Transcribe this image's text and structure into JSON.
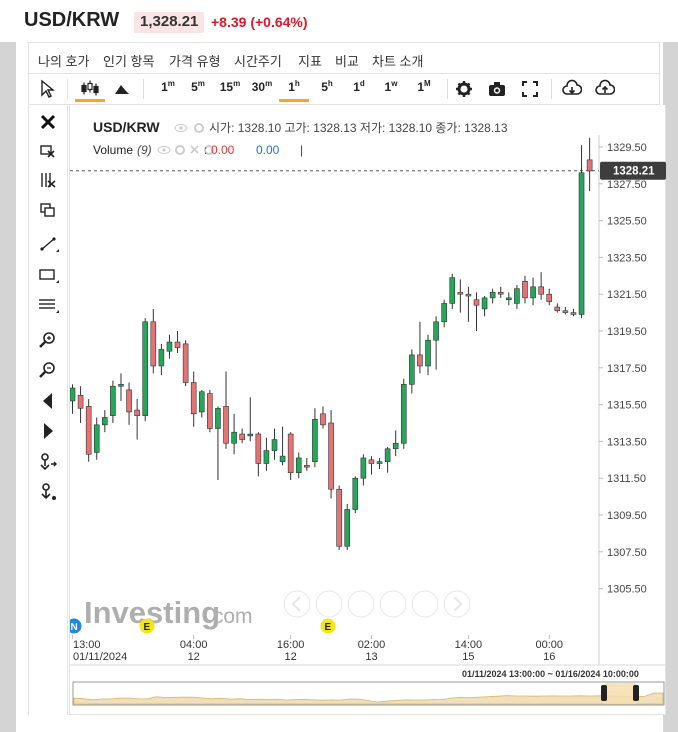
{
  "header": {
    "pair": "USD/KRW",
    "price": "1,328.21",
    "change": "+8.39 (+0.64%)"
  },
  "menu": [
    {
      "label": "나의 호가"
    },
    {
      "label": "인기 항목"
    },
    {
      "label": "가격 유형"
    },
    {
      "label": "시간주기"
    },
    {
      "label": "지표"
    },
    {
      "label": "비교"
    },
    {
      "label": "차트 소개"
    }
  ],
  "toolbar": {
    "intervals": [
      {
        "base": "1",
        "sup": "m"
      },
      {
        "base": "5",
        "sup": "m"
      },
      {
        "base": "15",
        "sup": "m"
      },
      {
        "base": "30",
        "sup": "m"
      },
      {
        "base": "1",
        "sup": "h",
        "active": true
      },
      {
        "base": "5",
        "sup": "h"
      },
      {
        "base": "1",
        "sup": "d"
      },
      {
        "base": "1",
        "sup": "w"
      },
      {
        "base": "1",
        "sup": "M"
      }
    ],
    "icons": [
      "cursor-icon",
      "candles-icon",
      "mountain-icon",
      "gear-icon",
      "camera-icon",
      "fullscreen-icon",
      "download-icon",
      "upload-icon"
    ]
  },
  "left_tools": [
    "close-icon",
    "cursor-cross-icon",
    "eraser-icon",
    "copy-icon",
    "line-tool-icon",
    "rectangle-tool-icon",
    "fibonacci-icon",
    "zoom-in-icon",
    "zoom-out-icon",
    "scroll-left-icon",
    "scroll-right-icon",
    "magnet-icon",
    "measure-icon"
  ],
  "legend": {
    "symbol": "USD/KRW",
    "ohlc": "시가: 1328.10 고가: 1328.13 저가: 1328.10 종가: 1328.13",
    "volume_label": "Volume",
    "volume_param": "(9)",
    "volume_v1": "0.00",
    "volume_v2": "0.00",
    "volume_sep": "|"
  },
  "price_marker": "1328.21",
  "watermark": {
    "brand": "Investing",
    "suffix": ".com"
  },
  "event_badges": [
    {
      "label": "N",
      "color": "#1e88e5"
    },
    {
      "label": "E",
      "color": "#f5e416"
    },
    {
      "label": "E",
      "color": "#f5e416"
    }
  ],
  "range_text": "01/11/2024 13:00:00 ~ 01/16/2024 10:00:00",
  "colors": {
    "up": "#26a65b",
    "down": "#e57373",
    "accent": "#f5a623"
  },
  "chart_data": {
    "type": "candlestick",
    "y_ticks": [
      "1329.50",
      "1327.50",
      "1325.50",
      "1323.50",
      "1321.50",
      "1319.50",
      "1317.50",
      "1315.50",
      "1313.50",
      "1311.50",
      "1309.50",
      "1307.50",
      "1305.50"
    ],
    "ylim": [
      1304.5,
      1330.6
    ],
    "x_ticks": [
      {
        "time": "13:00",
        "date": "01/11/2024",
        "index": 0
      },
      {
        "time": "04:00",
        "date": "12",
        "index": 15
      },
      {
        "time": "16:00",
        "date": "12",
        "index": 27
      },
      {
        "time": "02:00",
        "date": "13",
        "index": 37
      },
      {
        "time": "14:00",
        "date": "15",
        "index": 49
      },
      {
        "time": "00:00",
        "date": "16",
        "index": 59
      }
    ],
    "candles": [
      {
        "o": 1315.7,
        "h": 1316.6,
        "l": 1315.0,
        "c": 1316.4
      },
      {
        "o": 1316.0,
        "h": 1316.5,
        "l": 1314.5,
        "c": 1315.3
      },
      {
        "o": 1315.4,
        "h": 1315.8,
        "l": 1312.4,
        "c": 1312.8
      },
      {
        "o": 1312.9,
        "h": 1314.8,
        "l": 1312.5,
        "c": 1314.4
      },
      {
        "o": 1314.4,
        "h": 1315.2,
        "l": 1314.0,
        "c": 1314.8
      },
      {
        "o": 1314.9,
        "h": 1316.8,
        "l": 1314.5,
        "c": 1316.5
      },
      {
        "o": 1316.5,
        "h": 1317.2,
        "l": 1315.7,
        "c": 1316.6
      },
      {
        "o": 1316.3,
        "h": 1316.7,
        "l": 1314.4,
        "c": 1315.1
      },
      {
        "o": 1315.2,
        "h": 1315.8,
        "l": 1313.6,
        "c": 1314.9
      },
      {
        "o": 1314.9,
        "h": 1320.2,
        "l": 1314.6,
        "c": 1320.0
      },
      {
        "o": 1320.0,
        "h": 1320.7,
        "l": 1317.2,
        "c": 1317.6
      },
      {
        "o": 1317.6,
        "h": 1318.8,
        "l": 1317.1,
        "c": 1318.5
      },
      {
        "o": 1318.4,
        "h": 1319.3,
        "l": 1318.0,
        "c": 1318.9
      },
      {
        "o": 1318.9,
        "h": 1319.5,
        "l": 1318.3,
        "c": 1318.6
      },
      {
        "o": 1318.8,
        "h": 1319.0,
        "l": 1316.5,
        "c": 1316.7
      },
      {
        "o": 1316.7,
        "h": 1317.3,
        "l": 1314.3,
        "c": 1315.0
      },
      {
        "o": 1315.1,
        "h": 1316.3,
        "l": 1314.8,
        "c": 1316.2
      },
      {
        "o": 1316.1,
        "h": 1316.3,
        "l": 1314.0,
        "c": 1314.2
      },
      {
        "o": 1314.2,
        "h": 1315.4,
        "l": 1311.4,
        "c": 1315.3
      },
      {
        "o": 1315.4,
        "h": 1317.3,
        "l": 1313.1,
        "c": 1313.4
      },
      {
        "o": 1313.4,
        "h": 1315.0,
        "l": 1312.8,
        "c": 1314.0
      },
      {
        "o": 1313.9,
        "h": 1314.2,
        "l": 1313.4,
        "c": 1313.6
      },
      {
        "o": 1313.8,
        "h": 1315.9,
        "l": 1313.5,
        "c": 1313.9
      },
      {
        "o": 1313.9,
        "h": 1314.0,
        "l": 1311.6,
        "c": 1312.3
      },
      {
        "o": 1312.3,
        "h": 1313.7,
        "l": 1311.9,
        "c": 1313.0
      },
      {
        "o": 1313.0,
        "h": 1314.2,
        "l": 1312.5,
        "c": 1313.6
      },
      {
        "o": 1312.4,
        "h": 1314.3,
        "l": 1312.2,
        "c": 1312.7
      },
      {
        "o": 1313.9,
        "h": 1314.0,
        "l": 1311.4,
        "c": 1311.8
      },
      {
        "o": 1311.8,
        "h": 1312.9,
        "l": 1311.5,
        "c": 1312.6
      },
      {
        "o": 1312.2,
        "h": 1312.6,
        "l": 1311.9,
        "c": 1312.1
      },
      {
        "o": 1312.4,
        "h": 1315.3,
        "l": 1312.1,
        "c": 1314.7
      },
      {
        "o": 1315.0,
        "h": 1315.4,
        "l": 1314.2,
        "c": 1314.4
      },
      {
        "o": 1314.5,
        "h": 1315.2,
        "l": 1310.4,
        "c": 1310.9
      },
      {
        "o": 1310.9,
        "h": 1311.1,
        "l": 1307.6,
        "c": 1307.8
      },
      {
        "o": 1307.8,
        "h": 1310.1,
        "l": 1307.6,
        "c": 1309.8
      },
      {
        "o": 1309.8,
        "h": 1311.6,
        "l": 1309.6,
        "c": 1311.5
      },
      {
        "o": 1311.5,
        "h": 1312.8,
        "l": 1311.1,
        "c": 1312.6
      },
      {
        "o": 1312.5,
        "h": 1312.7,
        "l": 1311.7,
        "c": 1312.3
      },
      {
        "o": 1312.3,
        "h": 1312.6,
        "l": 1312.0,
        "c": 1312.4
      },
      {
        "o": 1312.4,
        "h": 1313.2,
        "l": 1311.8,
        "c": 1313.1
      },
      {
        "o": 1313.1,
        "h": 1314.1,
        "l": 1312.7,
        "c": 1313.4
      },
      {
        "o": 1313.4,
        "h": 1316.9,
        "l": 1313.1,
        "c": 1316.6
      },
      {
        "o": 1316.6,
        "h": 1318.5,
        "l": 1316.1,
        "c": 1318.2
      },
      {
        "o": 1318.2,
        "h": 1320.0,
        "l": 1317.2,
        "c": 1317.6
      },
      {
        "o": 1317.6,
        "h": 1319.3,
        "l": 1317.1,
        "c": 1319.0
      },
      {
        "o": 1319.0,
        "h": 1320.3,
        "l": 1317.4,
        "c": 1320.0
      },
      {
        "o": 1320.0,
        "h": 1321.2,
        "l": 1319.7,
        "c": 1321.0
      },
      {
        "o": 1321.0,
        "h": 1322.6,
        "l": 1320.7,
        "c": 1322.4
      },
      {
        "o": 1321.6,
        "h": 1322.3,
        "l": 1320.5,
        "c": 1321.5
      },
      {
        "o": 1321.5,
        "h": 1321.9,
        "l": 1320.0,
        "c": 1321.4
      },
      {
        "o": 1321.2,
        "h": 1321.6,
        "l": 1319.5,
        "c": 1320.9
      },
      {
        "o": 1320.7,
        "h": 1321.4,
        "l": 1320.3,
        "c": 1321.3
      },
      {
        "o": 1321.3,
        "h": 1321.8,
        "l": 1321.0,
        "c": 1321.6
      },
      {
        "o": 1321.6,
        "h": 1321.9,
        "l": 1321.3,
        "c": 1321.5
      },
      {
        "o": 1321.2,
        "h": 1321.6,
        "l": 1320.9,
        "c": 1321.3
      },
      {
        "o": 1321.0,
        "h": 1322.0,
        "l": 1320.7,
        "c": 1321.8
      },
      {
        "o": 1322.2,
        "h": 1322.5,
        "l": 1321.0,
        "c": 1321.3
      },
      {
        "o": 1321.3,
        "h": 1322.4,
        "l": 1320.9,
        "c": 1321.9
      },
      {
        "o": 1321.9,
        "h": 1322.7,
        "l": 1321.2,
        "c": 1321.5
      },
      {
        "o": 1321.5,
        "h": 1321.8,
        "l": 1320.9,
        "c": 1321.1
      },
      {
        "o": 1320.8,
        "h": 1321.0,
        "l": 1320.5,
        "c": 1320.6
      },
      {
        "o": 1320.6,
        "h": 1320.8,
        "l": 1320.4,
        "c": 1320.5
      },
      {
        "o": 1320.5,
        "h": 1320.7,
        "l": 1320.3,
        "c": 1320.4
      },
      {
        "o": 1320.4,
        "h": 1329.6,
        "l": 1320.2,
        "c": 1328.1
      },
      {
        "o": 1328.8,
        "h": 1330.0,
        "l": 1327.1,
        "c": 1328.2
      }
    ]
  }
}
